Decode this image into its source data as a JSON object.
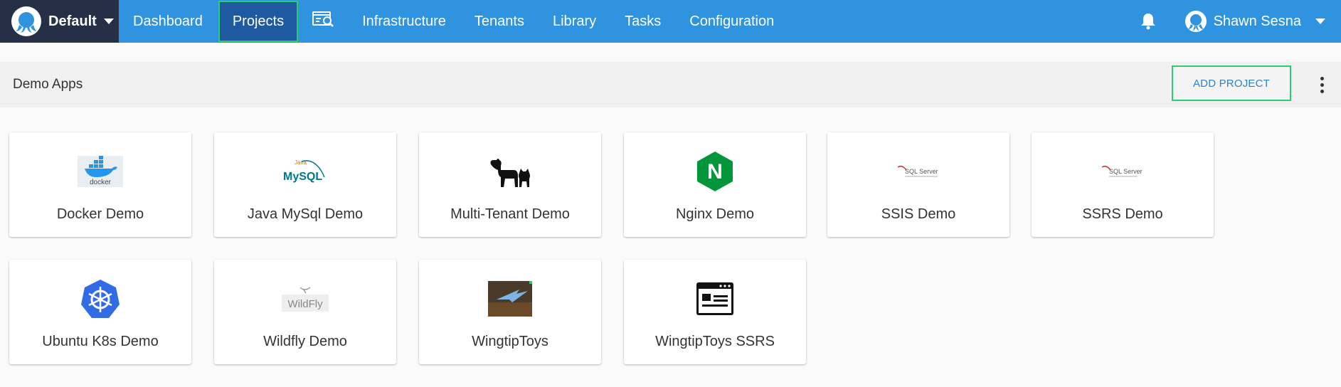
{
  "space": {
    "name": "Default"
  },
  "nav": {
    "dashboard": "Dashboard",
    "projects": "Projects",
    "infrastructure": "Infrastructure",
    "tenants": "Tenants",
    "library": "Library",
    "tasks": "Tasks",
    "configuration": "Configuration"
  },
  "user": {
    "name": "Shawn Sesna"
  },
  "group": {
    "title": "Demo Apps",
    "add_button": "ADD PROJECT"
  },
  "projects": [
    {
      "name": "Docker Demo",
      "logo": "docker-logo",
      "logo_text": "docker"
    },
    {
      "name": "Java MySql Demo",
      "logo": "mysql-logo",
      "logo_text": "MySQL"
    },
    {
      "name": "Multi-Tenant Demo",
      "logo": "dog-cat-icon"
    },
    {
      "name": "Nginx Demo",
      "logo": "nginx-logo",
      "logo_text": "N"
    },
    {
      "name": "SSIS Demo",
      "logo": "sql-server-logo",
      "logo_text": "SQL Server"
    },
    {
      "name": "SSRS Demo",
      "logo": "sql-server-logo",
      "logo_text": "SQL Server"
    },
    {
      "name": "Ubuntu K8s Demo",
      "logo": "kubernetes-logo"
    },
    {
      "name": "Wildfly Demo",
      "logo": "wildfly-logo",
      "logo_text": "WildFly"
    },
    {
      "name": "WingtipToys",
      "logo": "wingtip-toys-thumbnail"
    },
    {
      "name": "WingtipToys SSRS",
      "logo": "browser-window-icon"
    }
  ],
  "colors": {
    "topbar": "#2f93e0",
    "space_switcher": "#253046",
    "active_tab": "#1f5aa0",
    "highlight_outline": "#2ecc71",
    "nginx_green": "#009639",
    "kubernetes_blue": "#326ce5"
  }
}
